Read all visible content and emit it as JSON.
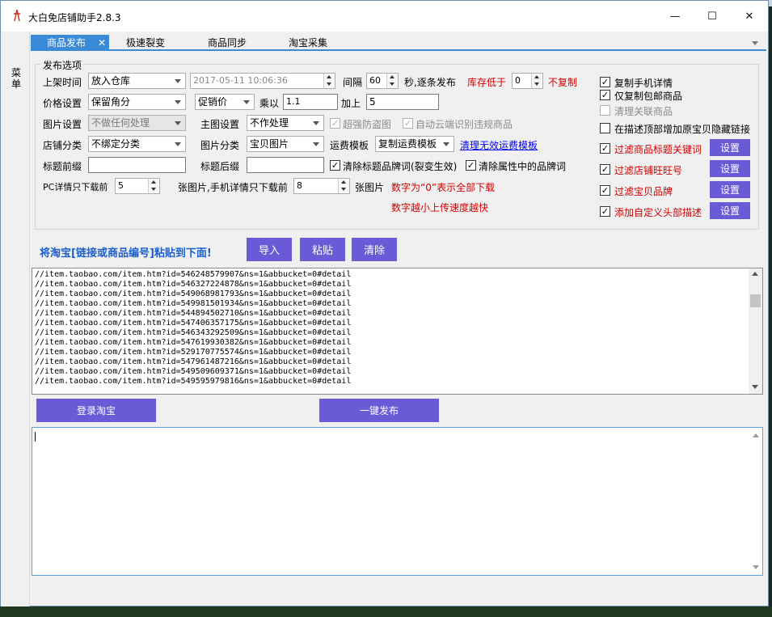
{
  "window": {
    "title": "大白免店铺助手2.8.3",
    "minimize": "—",
    "maximize": "☐",
    "close": "✕"
  },
  "sidebar": {
    "label": "菜单"
  },
  "tabs": [
    "商品发布",
    "极速裂变",
    "商品同步",
    "淘宝采集"
  ],
  "tab_close": "✕",
  "group_title": "发布选项",
  "row1": {
    "label": "上架时间",
    "select": "放入仓库",
    "datetime": "2017-05-11 10:06:36",
    "interval_label": "间隔",
    "interval": "60",
    "interval_suffix": "秒,逐条发布",
    "stock_label": "库存低于",
    "stock_value": "0",
    "stock_suffix": "不复制"
  },
  "row2": {
    "label": "价格设置",
    "select": "保留角分",
    "price_select": "促销价",
    "multiply_label": "乘以",
    "multiply": "1.1",
    "add_label": "加上",
    "add": "5"
  },
  "row3": {
    "label": "图片设置",
    "select": "不做任何处理",
    "main_label": "主图设置",
    "main_select": "不作处理",
    "anti_theft": "超强防盗图",
    "auto_cloud": "自动云端识别违规商品"
  },
  "row4": {
    "label": "店铺分类",
    "select": "不绑定分类",
    "img_cat_label": "图片分类",
    "img_cat": "宝贝图片",
    "freight_label": "运费模板",
    "freight": "复制运费模板",
    "clean_link": "清理无效运费模板"
  },
  "row5": {
    "prefix_label": "标题前缀",
    "suffix_label": "标题后缀",
    "clear_brand_title": "清除标题品牌词(裂变生效)",
    "clear_brand_attr": "清除属性中的品牌词"
  },
  "row6": {
    "pc_label": "PC详情只下载前",
    "pc_value": "5",
    "mid_label": "张图片,手机详情只下载前",
    "mobile_value": "8",
    "tail_label": "张图片",
    "hint1": "数字为“0”表示全部下载",
    "hint2": "数字越小上传速度越快"
  },
  "right_options": [
    {
      "label": "复制手机详情",
      "checked": true,
      "red": false,
      "disabled": false
    },
    {
      "label": "仅复制包邮商品",
      "checked": true,
      "red": false,
      "disabled": false
    },
    {
      "label": "清理关联商品",
      "checked": false,
      "red": false,
      "disabled": true
    },
    {
      "label": "在描述顶部增加原宝贝隐藏链接",
      "checked": false,
      "red": false,
      "disabled": false
    },
    {
      "label": "过滤商品标题关键词",
      "checked": true,
      "red": true,
      "disabled": false
    },
    {
      "label": "过滤店铺旺旺号",
      "checked": true,
      "red": true,
      "disabled": false
    },
    {
      "label": "过滤宝贝品牌",
      "checked": true,
      "red": true,
      "disabled": false
    },
    {
      "label": "添加自定义头部描述",
      "checked": true,
      "red": true,
      "disabled": false
    }
  ],
  "settings_label": "设置",
  "checkmark": "✓",
  "paste_hint": "将淘宝[链接或商品编号]粘贴到下面!",
  "actions": {
    "import": "导入",
    "paste": "粘贴",
    "clear": "清除"
  },
  "urls": [
    "//item.taobao.com/item.htm?id=546248579907&ns=1&abbucket=0#detail",
    "//item.taobao.com/item.htm?id=546327224878&ns=1&abbucket=0#detail",
    "//item.taobao.com/item.htm?id=549068981793&ns=1&abbucket=0#detail",
    "//item.taobao.com/item.htm?id=549981501934&ns=1&abbucket=0#detail",
    "//item.taobao.com/item.htm?id=544894502710&ns=1&abbucket=0#detail",
    "//item.taobao.com/item.htm?id=547406357175&ns=1&abbucket=0#detail",
    "//item.taobao.com/item.htm?id=546343292509&ns=1&abbucket=0#detail",
    "//item.taobao.com/item.htm?id=547619930382&ns=1&abbucket=0#detail",
    "//item.taobao.com/item.htm?id=529170775574&ns=1&abbucket=0#detail",
    "//item.taobao.com/item.htm?id=547961487216&ns=1&abbucket=0#detail",
    "//item.taobao.com/item.htm?id=549509609371&ns=1&abbucket=0#detail",
    "//item.taobao.com/item.htm?id=549595979816&ns=1&abbucket=0#detail"
  ],
  "bottom": {
    "login": "登录淘宝",
    "publish": "一键发布"
  }
}
